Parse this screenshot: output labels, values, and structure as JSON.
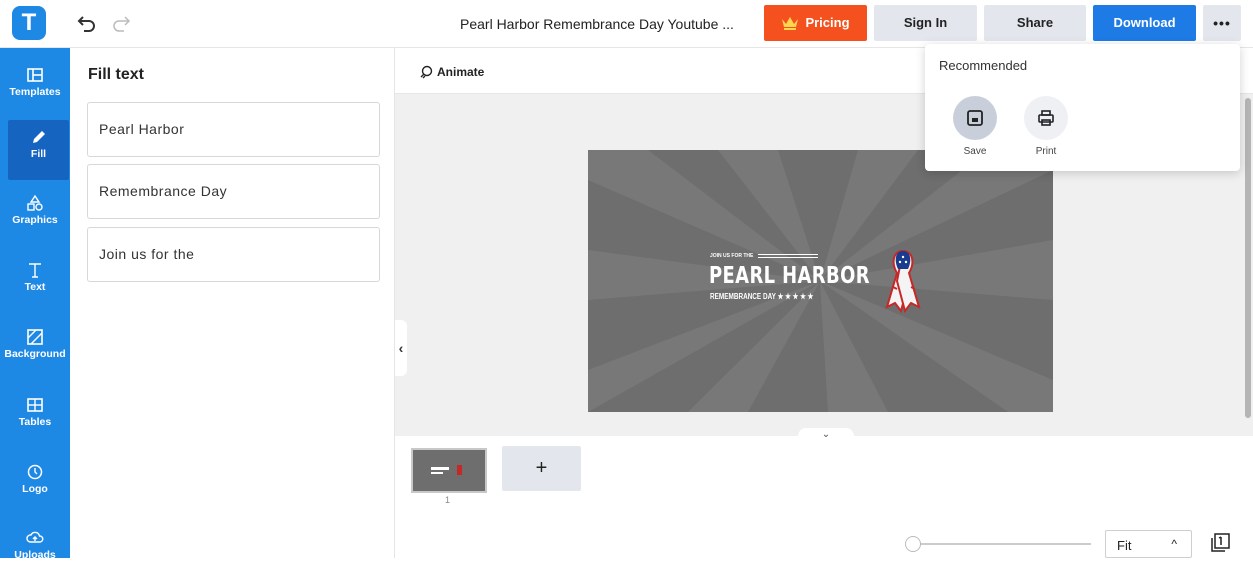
{
  "app": {
    "logo_letter": "T",
    "brand_color": "#1e88e5"
  },
  "header": {
    "doc_title": "Pearl Harbor Remembrance Day Youtube ...",
    "pricing_label": "Pricing",
    "signin_label": "Sign In",
    "share_label": "Share",
    "download_label": "Download",
    "more_label": "•••",
    "colors": {
      "pricing": "#f4511e",
      "download": "#1e7be6",
      "secondary": "#e3e7ed"
    }
  },
  "sidebar": {
    "items": [
      {
        "label": "Templates",
        "icon": "templates-icon"
      },
      {
        "label": "Fill",
        "icon": "pencil-icon",
        "active": true
      },
      {
        "label": "Graphics",
        "icon": "shapes-icon"
      },
      {
        "label": "Text",
        "icon": "text-icon"
      },
      {
        "label": "Background",
        "icon": "background-icon"
      },
      {
        "label": "Tables",
        "icon": "table-icon"
      },
      {
        "label": "Logo",
        "icon": "logo-icon"
      },
      {
        "label": "Uploads",
        "icon": "upload-cloud-icon"
      }
    ]
  },
  "panel": {
    "title": "Fill text",
    "fields": [
      "Pearl Harbor",
      "Remembrance Day",
      "Join us for the"
    ]
  },
  "canvas": {
    "animate_label": "Animate",
    "design": {
      "join_text": "JOIN US FOR THE",
      "title_text": "PEARL HARBOR",
      "subtitle_text": "REMEMBRANCE DAY ★ ★ ★ ★ ★"
    }
  },
  "pages": {
    "thumb_number": "1",
    "add_label": "+"
  },
  "zoom": {
    "value": "Fit",
    "caret": "^"
  },
  "download_menu": {
    "title": "Recommended",
    "items": [
      {
        "label": "Save",
        "icon": "save-icon",
        "selected": true
      },
      {
        "label": "Print",
        "icon": "print-icon"
      }
    ]
  }
}
